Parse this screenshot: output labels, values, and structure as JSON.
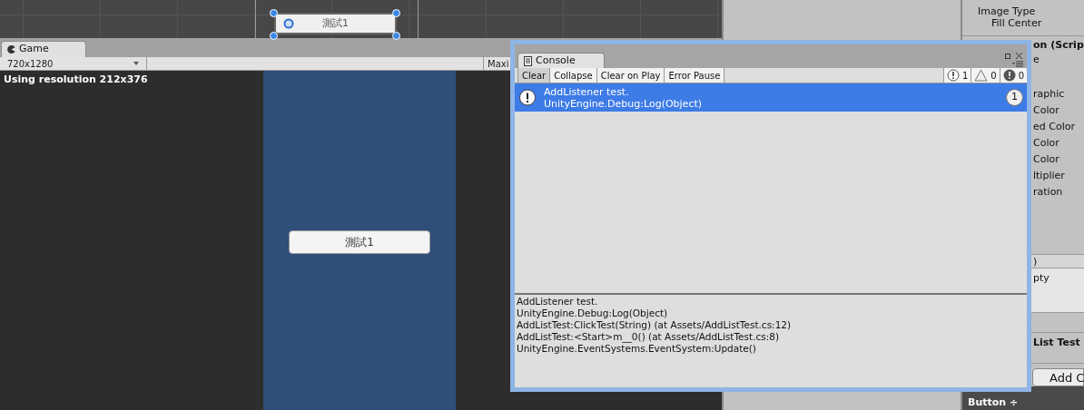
{
  "scene": {
    "selected_button": "測試1"
  },
  "game": {
    "tab": "Game",
    "resolution_dropdown": "720x1280",
    "maximize_button": "Maxi",
    "overlay_text": "Using resolution 212x376",
    "button": "測試1"
  },
  "inspector": {
    "top_rows": [
      "Image Type",
      "Fill Center"
    ],
    "partial_rows": [
      {
        "text": "on (Scrip",
        "kind": "header"
      },
      {
        "text": "e",
        "kind": "label"
      },
      {
        "text": "raphic",
        "kind": "label"
      },
      {
        "text": "Color",
        "kind": "label"
      },
      {
        "text": "ed Color",
        "kind": "label"
      },
      {
        "text": "Color",
        "kind": "label"
      },
      {
        "text": "Color",
        "kind": "label"
      },
      {
        "text": "ltiplier",
        "kind": "label"
      },
      {
        "text": "ration",
        "kind": "label"
      }
    ],
    "event_header": ")",
    "event_body": "pty",
    "component_title": "List Test",
    "add_button": "Add C",
    "footer_label": "Button ÷"
  },
  "console": {
    "tab": "Console",
    "toolbar": [
      "Clear",
      "Collapse",
      "Clear on Play",
      "Error Pause"
    ],
    "counters": [
      {
        "kind": "info",
        "count": "1"
      },
      {
        "kind": "warning",
        "count": "0"
      },
      {
        "kind": "error",
        "count": "0"
      }
    ],
    "entries": [
      {
        "lines": [
          "AddListener test.",
          "UnityEngine.Debug:Log(Object)"
        ],
        "count": "1",
        "selected": true
      }
    ],
    "details": [
      "AddListener test.",
      "UnityEngine.Debug:Log(Object)",
      "AddListTest:ClickTest(String) (at Assets/AddListTest.cs:12)",
      "AddListTest:<Start>m__0() (at Assets/AddListTest.cs:8)",
      "UnityEngine.EventSystems.EventSystem:Update()"
    ]
  }
}
